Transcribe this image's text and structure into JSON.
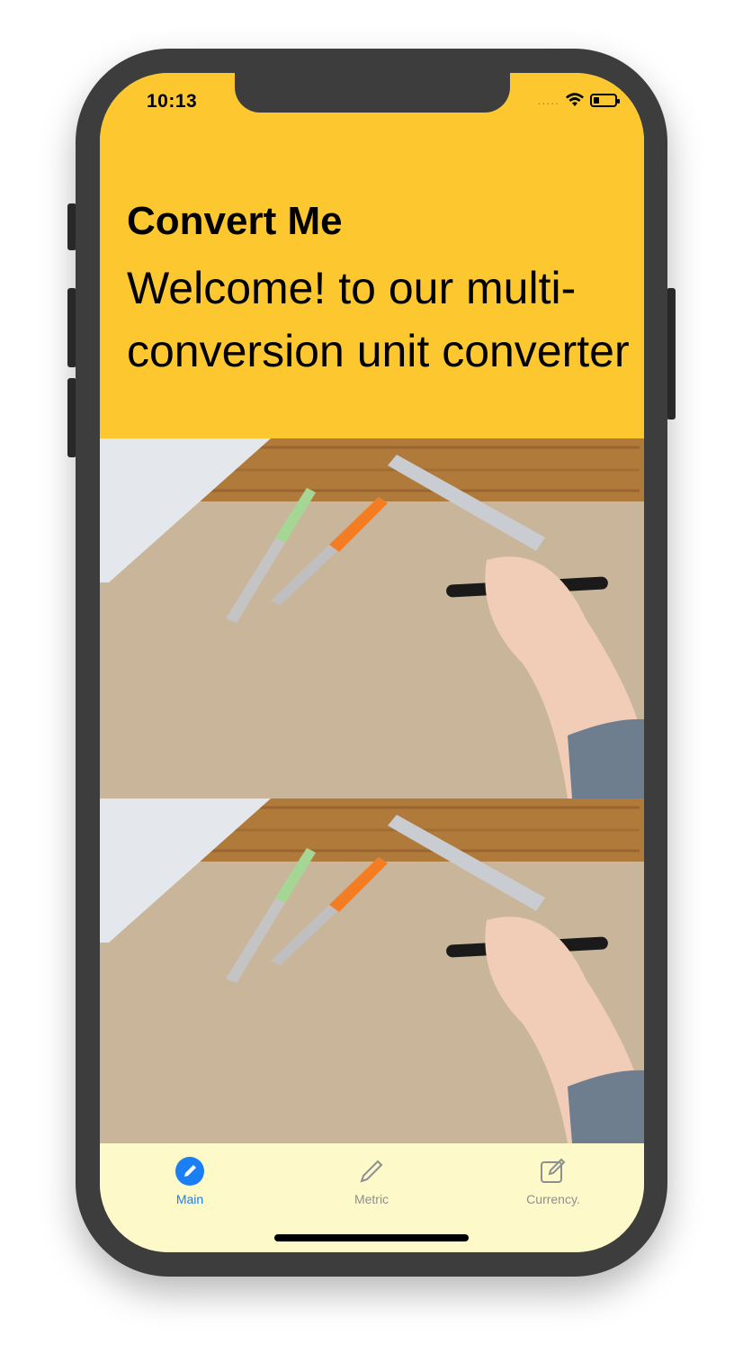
{
  "status_bar": {
    "time": "10:13",
    "signal": "....."
  },
  "header": {
    "title": "Convert Me",
    "welcome": "Welcome! to our multi-conversion unit converter"
  },
  "tabs": [
    {
      "label": "Main",
      "icon": "pencil-circle-icon",
      "active": true
    },
    {
      "label": "Metric",
      "icon": "pencil-icon",
      "active": false
    },
    {
      "label": "Currency.",
      "icon": "square-pencil-icon",
      "active": false
    }
  ],
  "colors": {
    "header_bg": "#fdc82f",
    "tabbar_bg": "#fdf9c9",
    "accent": "#1a7ef5",
    "inactive": "#8f8f8f"
  }
}
